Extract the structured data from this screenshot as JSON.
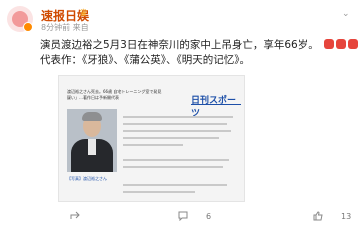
{
  "post": {
    "author": "速报日娱",
    "meta": "8分钟前 来自",
    "line1": "演员渡边裕之5月3日在神奈川的家中上吊身亡，享年66岁。",
    "line2": "代表作：《牙狼》、《蒲公英》、《明天的记忆》。"
  },
  "article_image": {
    "headline_lines": [
      "渡辺裕之さん死去。66歳 自宅トレーニング室で発見 「幅死された",
      "疑い」…著作日は予新開代表"
    ],
    "logo": "日刊スポーツ",
    "caption": "【写真】渡辺裕之さん"
  },
  "actions": {
    "comments": "6",
    "likes": "13"
  },
  "colors": {
    "author": "#d04a00",
    "accent": "#ff8a00",
    "logo": "#1d4fa8"
  },
  "icons": [
    "verified-badge-icon",
    "crown-icon",
    "chevron-down-icon",
    "emoji-icon",
    "share-icon",
    "comment-icon",
    "like-icon"
  ]
}
